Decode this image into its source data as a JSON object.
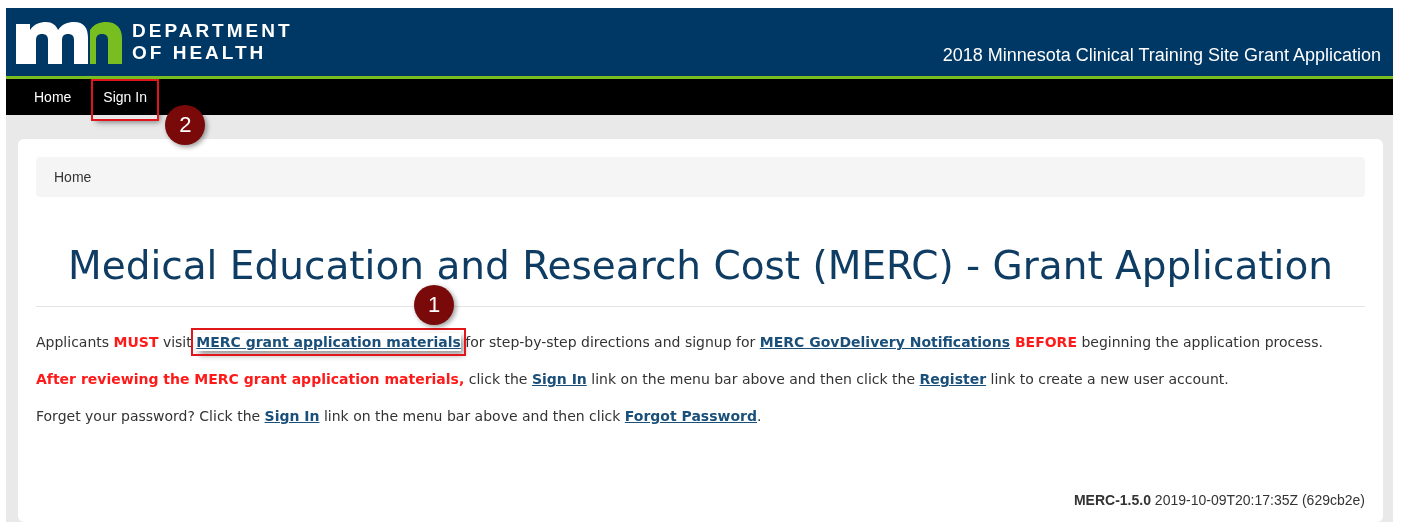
{
  "header": {
    "logo_lines": [
      "DEPARTMENT",
      "OF HEALTH"
    ],
    "app_title": "2018 Minnesota Clinical Training Site Grant Application"
  },
  "nav": [
    {
      "label": "Home",
      "highlighted": false
    },
    {
      "label": "Sign In",
      "highlighted": true,
      "callout": "2"
    }
  ],
  "breadcrumb": "Home",
  "heading": "Medical Education and Research Cost (MERC) - Grant Application",
  "paragraphs": [
    [
      {
        "kind": "text",
        "text": "Applicants "
      },
      {
        "kind": "emphasis",
        "text": "MUST"
      },
      {
        "kind": "text",
        "text": " visit "
      },
      {
        "kind": "link",
        "text": "MERC grant application materials",
        "highlighted": true,
        "callout": "1"
      },
      {
        "kind": "text",
        "text": " for step-by-step directions and signup for "
      },
      {
        "kind": "link",
        "text": "MERC GovDelivery Notifications",
        "highlighted": false
      },
      {
        "kind": "emphasis",
        "text": " BEFORE"
      },
      {
        "kind": "text",
        "text": " beginning the application process."
      }
    ],
    [
      {
        "kind": "emphasis",
        "text": "After reviewing the MERC grant application materials,"
      },
      {
        "kind": "text",
        "text": " click the "
      },
      {
        "kind": "link",
        "text": "Sign In",
        "highlighted": false
      },
      {
        "kind": "text",
        "text": " link on the menu bar above and then click the "
      },
      {
        "kind": "link",
        "text": "Register",
        "highlighted": false
      },
      {
        "kind": "text",
        "text": " link to create a new user account."
      }
    ],
    [
      {
        "kind": "text",
        "text": "Forget your password? Click the "
      },
      {
        "kind": "link",
        "text": "Sign In",
        "highlighted": false
      },
      {
        "kind": "text",
        "text": " link on the menu bar above and then click "
      },
      {
        "kind": "link",
        "text": "Forgot Password",
        "highlighted": false
      },
      {
        "kind": "text",
        "text": "."
      }
    ]
  ],
  "footer": {
    "version": "MERC-1.5.0",
    "build": "2019-10-09T20:17:35Z (629cb2e)"
  }
}
